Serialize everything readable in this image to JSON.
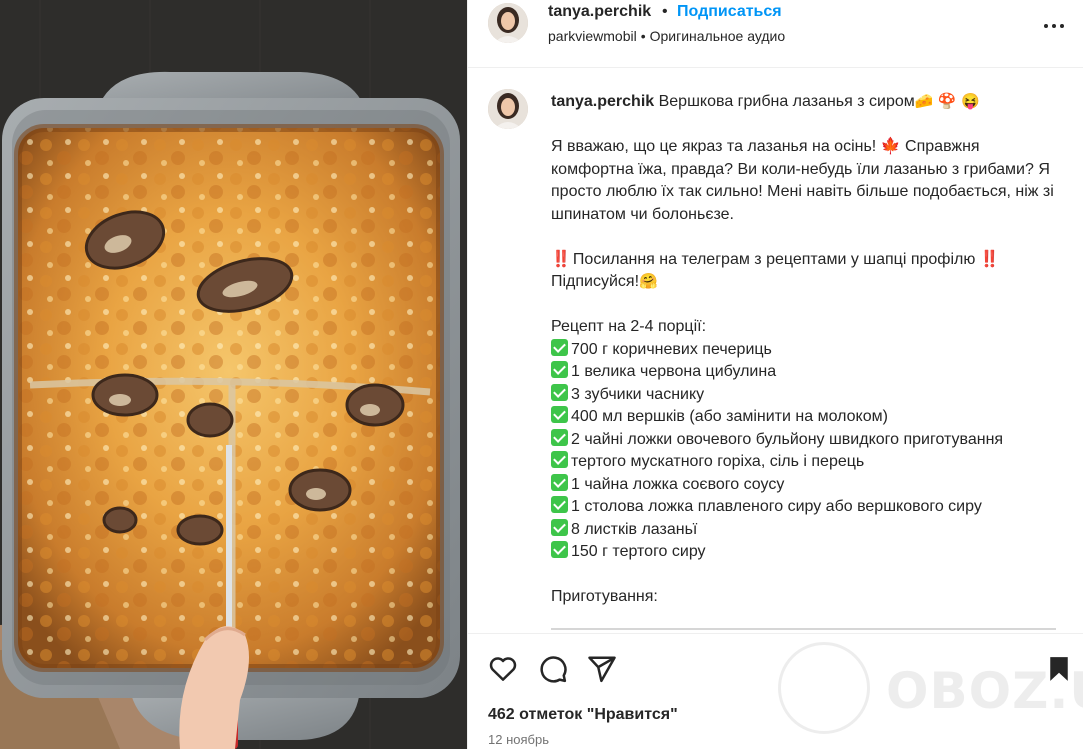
{
  "post": {
    "username": "tanya.perchik",
    "follow_label": "Подписаться",
    "dot": "•",
    "audio_artist": "parkviewmobil",
    "audio_sep": "•",
    "audio_label": "Оригинальное аудио"
  },
  "caption": {
    "username": "tanya.perchik",
    "title": "Вершкова грибна лазанья з сиром",
    "title_emojis": [
      "🧀",
      "🍄",
      "😝"
    ],
    "intro": "Я вважаю, що це якраз та лазанья на осінь! 🍁 Справжня комфортна їжа, правда? Ви коли-небудь їли лазанью з грибами? Я просто люблю їх так сильно! Мені навіть більше подобається, ніж зі шпинатом чи болоньєзе.",
    "link_note": "Посилання на телеграм з рецептами у шапці профілю",
    "bang": "‼️",
    "subscribe": "Підписуйся!",
    "subscribe_emoji": "🤗",
    "recipe_title": "Рецепт на 2-4 порції:",
    "ingredients": [
      "700 г коричневих печериць",
      "1 велика червона цибулина",
      "3 зубчики часнику",
      "400 мл вершків (або замінити на молоком)",
      "2 чайні ложки овочевого бульйону швидкого приготування",
      "тертого мускатного горіха, сіль і перець",
      "1 чайна ложка соєвого соусу",
      "1 столова ложка плавленого сиру або вершкового сиру",
      "8 листків лазаньї",
      "150 г тертого сиру"
    ],
    "prep_title": "Приготування:"
  },
  "footer": {
    "likes": "462 отметок \"Нравится\"",
    "date": "12 ноябрь"
  },
  "icons": {
    "more": "more-options-icon",
    "like": "heart-icon",
    "comment": "comment-icon",
    "share": "share-icon",
    "save": "bookmark-icon"
  },
  "watermark": {
    "text": "OBOZ.UA"
  },
  "colors": {
    "accent": "#0095f6",
    "check": "#3ec54a",
    "text": "#262626",
    "muted": "#737373"
  }
}
